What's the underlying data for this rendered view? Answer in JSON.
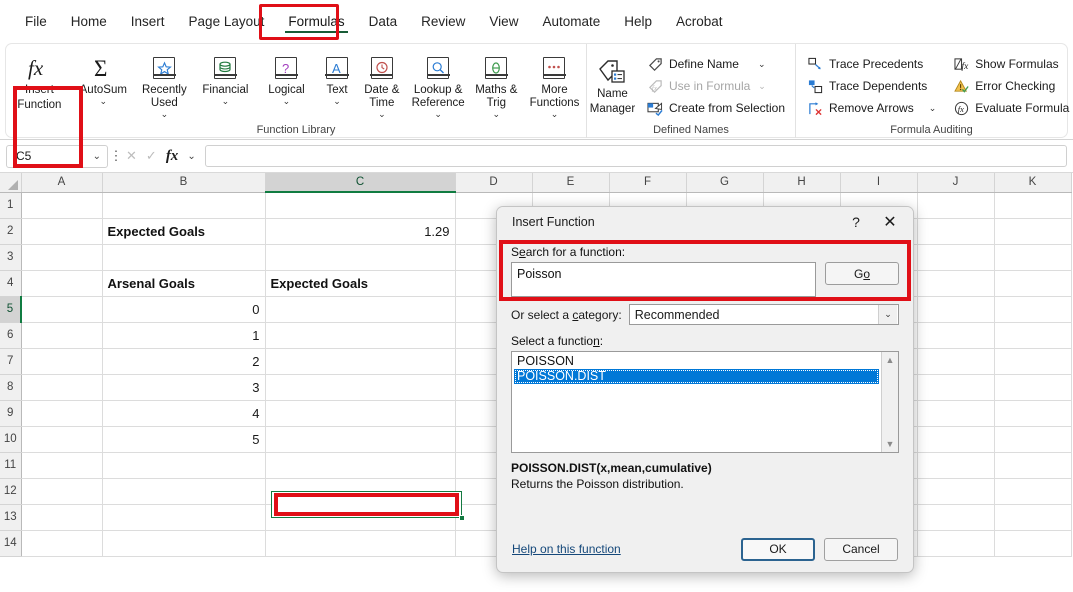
{
  "ribbon": {
    "tabs": [
      {
        "label": "File",
        "active": false
      },
      {
        "label": "Home",
        "active": false
      },
      {
        "label": "Insert",
        "active": false
      },
      {
        "label": "Page Layout",
        "active": false
      },
      {
        "label": "Formulas",
        "active": true
      },
      {
        "label": "Data",
        "active": false
      },
      {
        "label": "Review",
        "active": false
      },
      {
        "label": "View",
        "active": false
      },
      {
        "label": "Automate",
        "active": false
      },
      {
        "label": "Help",
        "active": false
      },
      {
        "label": "Acrobat",
        "active": false
      }
    ],
    "groups": {
      "function_library": {
        "label": "Function Library",
        "insert_function": {
          "line1": "Insert",
          "line2": "Function"
        },
        "buttons": [
          {
            "label": "AutoSum",
            "icon": "sigma-icon",
            "caret": "⌄"
          },
          {
            "label": "Recently Used",
            "icon": "star-book-icon",
            "caret": "⌄"
          },
          {
            "label": "Financial",
            "icon": "coins-book-icon",
            "caret": "⌄"
          },
          {
            "label": "Logical",
            "icon": "question-book-icon",
            "caret": "⌄"
          },
          {
            "label": "Text",
            "icon": "letter-a-book-icon",
            "caret": "⌄"
          },
          {
            "label": "Date & Time",
            "icon": "clock-book-icon",
            "caret": "⌄"
          },
          {
            "label": "Lookup & Reference",
            "icon": "magnifier-book-icon",
            "caret": "⌄"
          },
          {
            "label": "Maths & Trig",
            "icon": "theta-book-icon",
            "caret": "⌄"
          },
          {
            "label": "More Functions",
            "icon": "ellipsis-book-icon",
            "caret": "⌄"
          }
        ]
      },
      "defined_names": {
        "label": "Defined Names",
        "name_manager": {
          "line1": "Name",
          "line2": "Manager"
        },
        "commands": [
          {
            "label": "Define Name",
            "icon": "tag-icon",
            "chev": "⌄",
            "disabled": false
          },
          {
            "label": "Use in Formula",
            "icon": "tag-fx-icon",
            "chev": "⌄",
            "disabled": true
          },
          {
            "label": "Create from Selection",
            "icon": "create-selection-icon",
            "chev": "",
            "disabled": false
          }
        ]
      },
      "formula_auditing": {
        "label": "Formula Auditing",
        "col1": [
          {
            "label": "Trace Precedents",
            "icon": "trace-precedents-icon",
            "chev": ""
          },
          {
            "label": "Trace Dependents",
            "icon": "trace-dependents-icon",
            "chev": ""
          },
          {
            "label": "Remove Arrows",
            "icon": "remove-arrows-icon",
            "chev": "⌄"
          }
        ],
        "col2": [
          {
            "label": "Show Formulas",
            "icon": "show-formulas-icon",
            "chev": ""
          },
          {
            "label": "Error Checking",
            "icon": "error-checking-icon",
            "chev": "⌄"
          },
          {
            "label": "Evaluate Formula",
            "icon": "evaluate-formula-icon",
            "chev": ""
          }
        ]
      }
    }
  },
  "formula_bar": {
    "name_box_value": "C5",
    "name_box_chevron": "⌄",
    "cancel_icon": "✕",
    "confirm_icon": "✓",
    "fx_icon": "fx",
    "fx_chevron": "⌄",
    "formula_value": "",
    "more_options_icon": "⋮"
  },
  "grid": {
    "columns": [
      "A",
      "B",
      "C",
      "D",
      "E",
      "F",
      "G",
      "H",
      "I",
      "J",
      "K"
    ],
    "selected_column": "C",
    "rows": [
      "1",
      "2",
      "3",
      "4",
      "5",
      "6",
      "7",
      "8",
      "9",
      "10",
      "11",
      "12",
      "13",
      "14"
    ],
    "selected_row": "5",
    "cells": {
      "B2": "Expected Goals",
      "C2": "1.29",
      "B4": "Arsenal Goals",
      "C4": "Expected Goals",
      "B5": "0",
      "B6": "1",
      "B7": "2",
      "B8": "3",
      "B9": "4",
      "B10": "5",
      "C5": "",
      "C6": "",
      "C7": "",
      "C8": "",
      "C9": "",
      "C10": ""
    },
    "active_cell": "C5"
  },
  "dialog": {
    "title": "Insert Function",
    "help_icon": "?",
    "close_icon": "✕",
    "search_label_pre": "S",
    "search_label_u": "e",
    "search_label_post": "arch for a function:",
    "search_value": "Poisson",
    "go_button_pre": "G",
    "go_button_u": "o",
    "category_label_pre": "Or select a ",
    "category_label_u": "c",
    "category_label_post": "ategory:",
    "category_value": "Recommended",
    "category_chevron": "⌄",
    "select_label_pre": "Select a functio",
    "select_label_u": "n",
    "select_label_post": ":",
    "functions": [
      {
        "name": "POISSON",
        "selected": false
      },
      {
        "name": "POISSON.DIST",
        "selected": true
      }
    ],
    "scroll_up_icon": "▲",
    "scroll_down_icon": "▼",
    "function_signature": "POISSON.DIST(x,mean,cumulative)",
    "function_description": "Returns the Poisson distribution.",
    "help_link": "Help on this function",
    "ok_label": "OK",
    "cancel_label": "Cancel"
  },
  "colors": {
    "accent_green": "#107c41",
    "highlight_red": "#e00f17",
    "selection_blue": "#0078d7",
    "link_blue": "#15487a"
  }
}
